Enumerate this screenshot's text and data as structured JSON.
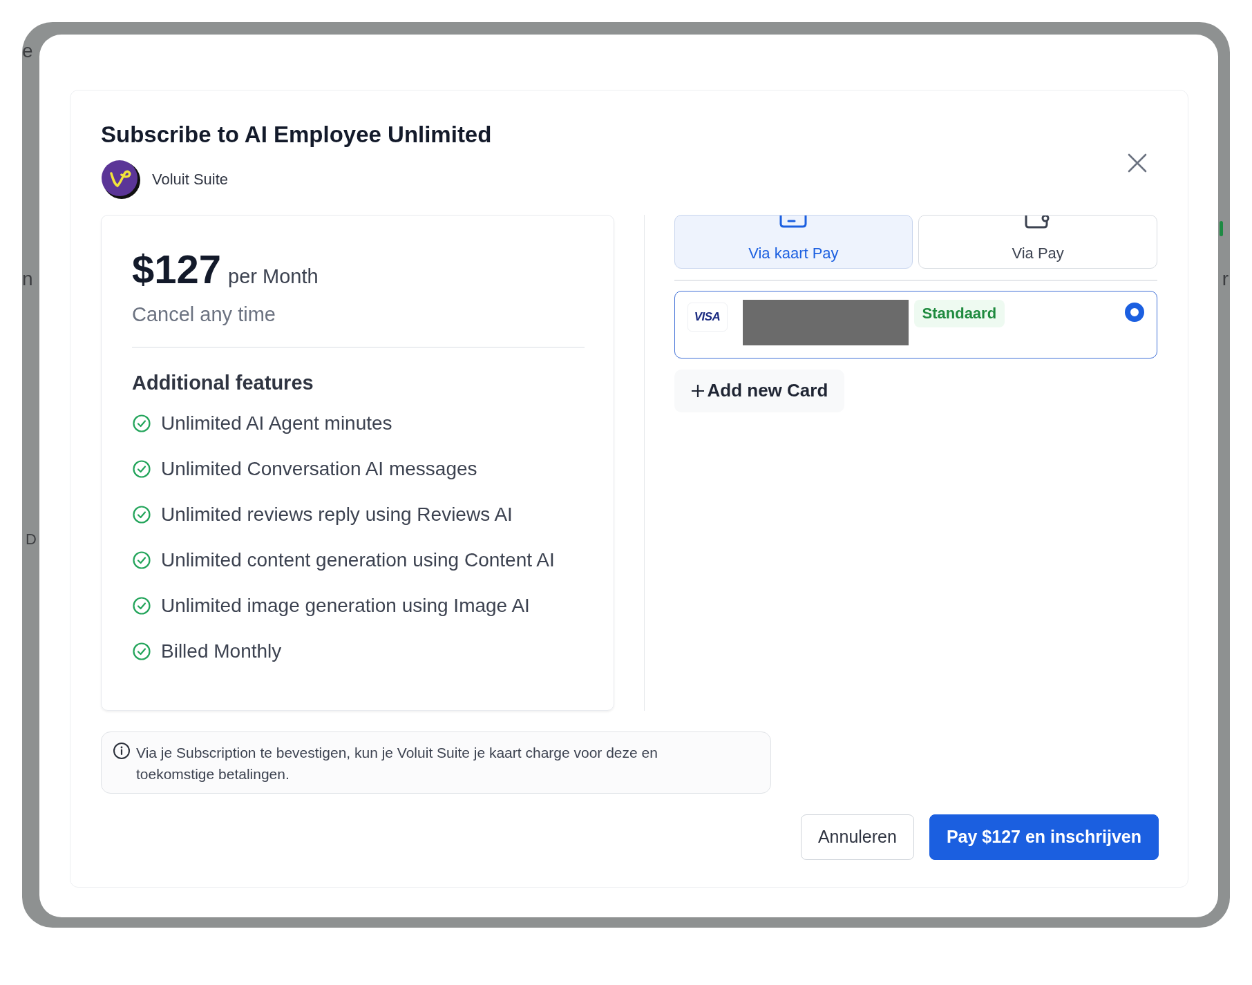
{
  "backdrop": {
    "left_fragments": [
      "e",
      "n",
      "D"
    ],
    "right_fragments": [
      "r"
    ]
  },
  "dialog": {
    "title": "Subscribe to AI Employee Unlimited",
    "brand": "Voluit Suite"
  },
  "plan": {
    "price": "$127",
    "period": "per Month",
    "note": "Cancel any time"
  },
  "features": {
    "heading": "Additional features",
    "items": [
      "Unlimited AI Agent minutes",
      "Unlimited Conversation AI messages",
      "Unlimited reviews reply using Reviews AI",
      "Unlimited content generation using Content AI",
      "Unlimited image generation using Image AI",
      "Billed Monthly"
    ]
  },
  "payment_tabs": [
    {
      "label": "Via kaart Pay",
      "selected": true
    },
    {
      "label": "Via Pay",
      "selected": false
    }
  ],
  "saved_cards": [
    {
      "brand": "VISA",
      "badge": "Standaard",
      "selected": true
    }
  ],
  "add_card": {
    "label": "Add new Card"
  },
  "notice": "Via je Subscription te bevestigen, kun je Voluit Suite je kaart charge voor deze en toekomstige betalingen.",
  "buttons": [
    {
      "label": "Annuleren",
      "kind": "secondary"
    },
    {
      "label": "Pay $127 en inschrijven",
      "kind": "primary"
    }
  ]
}
